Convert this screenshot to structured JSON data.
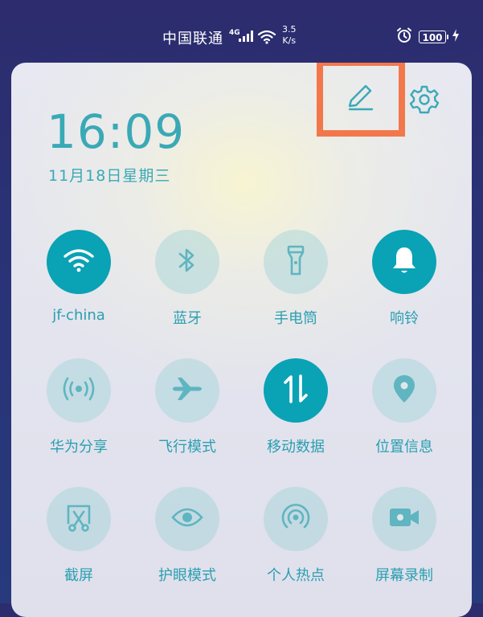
{
  "status_bar": {
    "carrier": "中国联通",
    "network_type": "4G",
    "speed_value": "3.5",
    "speed_unit": "K/s",
    "battery": "100"
  },
  "header": {
    "time": "16:09",
    "date": "11月18日星期三"
  },
  "tiles": [
    {
      "label": "jf-china",
      "icon": "wifi-icon",
      "state": "on"
    },
    {
      "label": "蓝牙",
      "icon": "bluetooth-icon",
      "state": "off"
    },
    {
      "label": "手电筒",
      "icon": "flashlight-icon",
      "state": "off"
    },
    {
      "label": "响铃",
      "icon": "bell-icon",
      "state": "on"
    },
    {
      "label": "华为分享",
      "icon": "huawei-share-icon",
      "state": "off"
    },
    {
      "label": "飞行模式",
      "icon": "airplane-icon",
      "state": "off"
    },
    {
      "label": "移动数据",
      "icon": "mobile-data-icon",
      "state": "on"
    },
    {
      "label": "位置信息",
      "icon": "location-icon",
      "state": "off"
    },
    {
      "label": "截屏",
      "icon": "screenshot-icon",
      "state": "off"
    },
    {
      "label": "护眼模式",
      "icon": "eye-icon",
      "state": "off"
    },
    {
      "label": "个人热点",
      "icon": "hotspot-icon",
      "state": "off"
    },
    {
      "label": "屏幕录制",
      "icon": "screen-record-icon",
      "state": "off"
    }
  ],
  "colors": {
    "accent": "#0aa2b5",
    "highlight_box": "#f2784b"
  }
}
